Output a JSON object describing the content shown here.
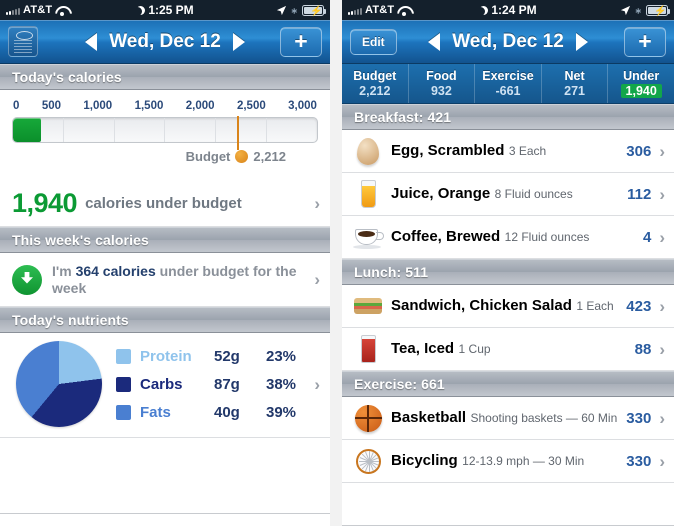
{
  "left": {
    "statusbar": {
      "carrier": "AT&T",
      "time": "1:25 PM",
      "wifi_icon": "wifi-icon",
      "moon_icon": "moon-icon",
      "location_icon": "location-arrow-icon",
      "bluetooth_icon": "bluetooth-icon",
      "battery_icon": "battery-charging-icon"
    },
    "navbar": {
      "scale_icon": "scale-icon",
      "prev_label": "◀",
      "title": "Wed, Dec 12",
      "next_label": "▶",
      "add_label": "+"
    },
    "sections": {
      "today_calories": "Today's calories",
      "week_calories": "This week's calories",
      "today_nutrients": "Today's nutrients"
    },
    "scale": {
      "ticks": [
        "0",
        "500",
        "1,000",
        "1,500",
        "2,000",
        "2,500",
        "3,000"
      ],
      "budget_label": "Budget",
      "budget_value": "2,212",
      "consumed": 272,
      "budget": 2212,
      "max": 3000,
      "fill_color": "#0b8f2b",
      "marker_color": "#d9841a"
    },
    "under_budget": {
      "amount": "1,940",
      "text": "calories under budget",
      "chevron": "›",
      "color": "#0b9a34"
    },
    "week": {
      "prefix": "I'm ",
      "highlight": "364 calories",
      "suffix": " under budget for the week",
      "arrow_icon": "down-arrow-circle-icon",
      "chevron": "›"
    },
    "nutrients": {
      "chevron": "›",
      "rows": [
        {
          "name": "Protein",
          "grams": "52g",
          "percent": "23%",
          "color": "#8fc3ec"
        },
        {
          "name": "Carbs",
          "grams": "87g",
          "percent": "38%",
          "color": "#1b2a7c"
        },
        {
          "name": "Fats",
          "grams": "40g",
          "percent": "39%",
          "color": "#4a7fd1"
        }
      ]
    }
  },
  "right": {
    "statusbar": {
      "carrier": "AT&T",
      "time": "1:24 PM",
      "wifi_icon": "wifi-icon",
      "moon_icon": "moon-icon",
      "location_icon": "location-arrow-icon",
      "bluetooth_icon": "bluetooth-icon",
      "battery_icon": "battery-charging-icon"
    },
    "navbar": {
      "edit_label": "Edit",
      "prev_label": "◀",
      "title": "Wed, Dec 12",
      "next_label": "▶",
      "add_label": "+"
    },
    "stats": [
      {
        "label": "Budget",
        "value": "2,212",
        "highlight": false
      },
      {
        "label": "Food",
        "value": "932",
        "highlight": false
      },
      {
        "label": "Exercise",
        "value": "-661",
        "highlight": false
      },
      {
        "label": "Net",
        "value": "271",
        "highlight": false
      },
      {
        "label": "Under",
        "value": "1,940",
        "highlight": true,
        "highlight_color": "#12a64a"
      }
    ],
    "groups": [
      {
        "header": "Breakfast: 421",
        "items": [
          {
            "icon": "egg-icon",
            "name": "Egg, Scrambled",
            "sub": "3 Each",
            "calories": "306",
            "chevron": "›"
          },
          {
            "icon": "orange-juice-glass-icon",
            "name": "Juice, Orange",
            "sub": "8 Fluid ounces",
            "calories": "112",
            "chevron": "›"
          },
          {
            "icon": "coffee-cup-icon",
            "name": "Coffee, Brewed",
            "sub": "12 Fluid ounces",
            "calories": "4",
            "chevron": "›"
          }
        ]
      },
      {
        "header": "Lunch: 511",
        "items": [
          {
            "icon": "sandwich-icon",
            "name": "Sandwich, Chicken Salad",
            "sub": "1 Each",
            "calories": "423",
            "chevron": "›"
          },
          {
            "icon": "iced-tea-glass-icon",
            "name": "Tea, Iced",
            "sub": "1 Cup",
            "calories": "88",
            "chevron": "›"
          }
        ]
      },
      {
        "header": "Exercise: 661",
        "items": [
          {
            "icon": "basketball-icon",
            "name": "Basketball",
            "sub": "Shooting baskets — 60 Min",
            "calories": "330",
            "chevron": "›"
          },
          {
            "icon": "bicycle-wheel-icon",
            "name": "Bicycling",
            "sub": "12-13.9 mph — 30 Min",
            "calories": "330",
            "chevron": "›"
          }
        ]
      }
    ]
  },
  "chart_data": {
    "type": "pie",
    "title": "Today's nutrients",
    "categories": [
      "Protein",
      "Carbs",
      "Fats"
    ],
    "values": [
      23,
      38,
      39
    ],
    "grams": [
      52,
      87,
      40
    ],
    "colors": [
      "#8fc3ec",
      "#1b2a7c",
      "#4a7fd1"
    ],
    "unit": "%",
    "legend": "right"
  }
}
